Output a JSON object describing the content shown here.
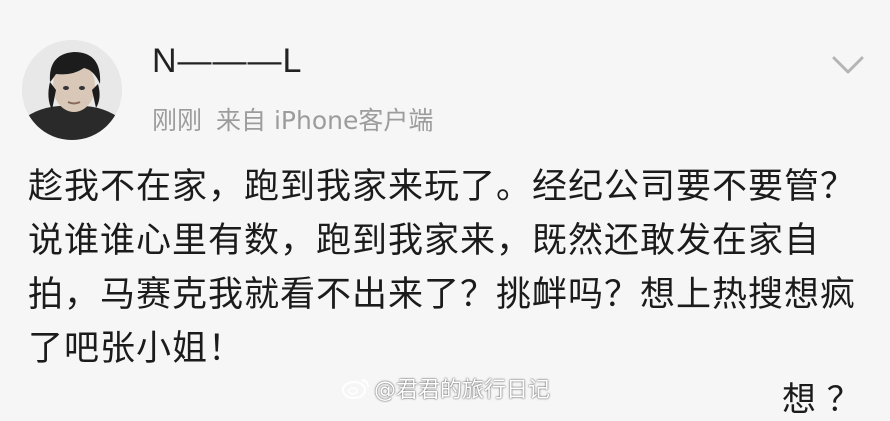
{
  "post": {
    "username": "N———L",
    "time": "刚刚",
    "source": "来自 iPhone客户端",
    "content": "趁我不在家，跑到我家来玩了。经纪公司要不要管？说谁谁心里有数，跑到我家来，既然还敢发在家自拍，马赛克我就看不出来了？挑衅吗？想上热搜想疯了吧张小姐！",
    "next_line_partial": "想 ？"
  },
  "watermark": {
    "text": "@君君的旅行日记"
  },
  "icons": {
    "avatar": "avatar",
    "menu": "chevron-down-icon",
    "watermark_logo": "weibo-logo-icon"
  }
}
